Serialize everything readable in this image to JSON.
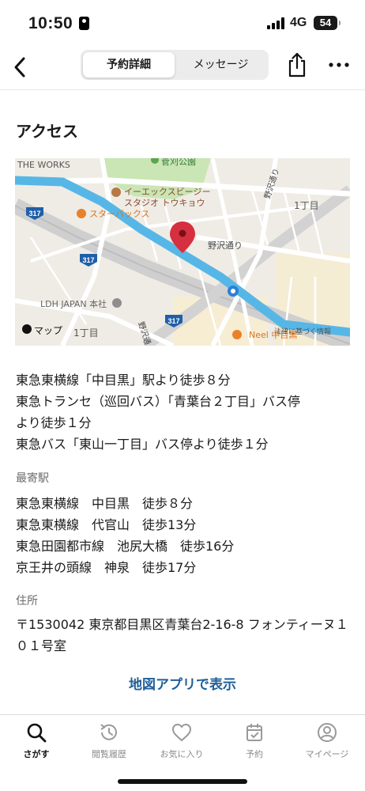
{
  "status_bar": {
    "time": "10:50",
    "network": "4G",
    "battery": "54",
    "icons": [
      "id-badge-icon",
      "signal-icon",
      "battery-icon"
    ]
  },
  "header": {
    "back_icon": "chevron-left-icon",
    "tabs": [
      {
        "label": "予約詳細",
        "active": true
      },
      {
        "label": "メッセージ",
        "active": false
      }
    ],
    "share_icon": "share-icon",
    "more_icon": "more-horizontal-icon"
  },
  "access": {
    "title": "アクセス",
    "map": {
      "labels": {
        "the_works": "THE WORKS",
        "park": "菅刈公園",
        "studio_line1": "イーエックスビージー",
        "studio_line2": "スタジオ トウキョウ",
        "starbucks": "スターバックス",
        "chome_right": "1丁目",
        "nozawa_road": "野沢通り",
        "ldh": "LDH JAPAN 本社",
        "route_317_a": "317",
        "route_317_b": "317",
        "route_317_c": "317",
        "chome_bottom": "1丁目",
        "maps_brand": "マップ",
        "legal": "法律に基づく情報",
        "neel": "Neel 中目黒",
        "nozawa_vertical_top": "野沢通り",
        "nozawa_vertical_bottom": "野沢通"
      },
      "colors": {
        "river": "#56b7e6",
        "pin": "#d63040",
        "park": "#c9e6b4",
        "land": "#efece6",
        "road": "#ffffff",
        "highway": "#c9c9c9",
        "poi_orange": "#e8812a"
      }
    },
    "routes": [
      "東急東横線「中目黒」駅より徒歩８分",
      "東急トランセ（巡回バス）「青葉台２丁目」バス停",
      "より徒歩１分",
      "東急バス「東山一丁目」バス停より徒歩１分"
    ]
  },
  "nearest_station": {
    "label": "最寄駅",
    "items": [
      "東急東横線　中目黒　徒歩８分",
      "東急東横線　代官山　徒歩13分",
      "東急田園都市線　池尻大橋　徒歩16分",
      "京王井の頭線　神泉　徒歩17分"
    ]
  },
  "address": {
    "label": "住所",
    "value": "〒1530042 東京都目黒区青葉台2-16-8 フォンティーヌ１０１号室"
  },
  "map_link": "地図アプリで表示",
  "tabbar": {
    "tabs": [
      {
        "label": "さがす",
        "icon": "search-icon",
        "active": true
      },
      {
        "label": "閲覧履歴",
        "icon": "history-icon",
        "active": false
      },
      {
        "label": "お気に入り",
        "icon": "heart-icon",
        "active": false
      },
      {
        "label": "予約",
        "icon": "calendar-icon",
        "active": false
      },
      {
        "label": "マイページ",
        "icon": "user-icon",
        "active": false
      }
    ]
  }
}
